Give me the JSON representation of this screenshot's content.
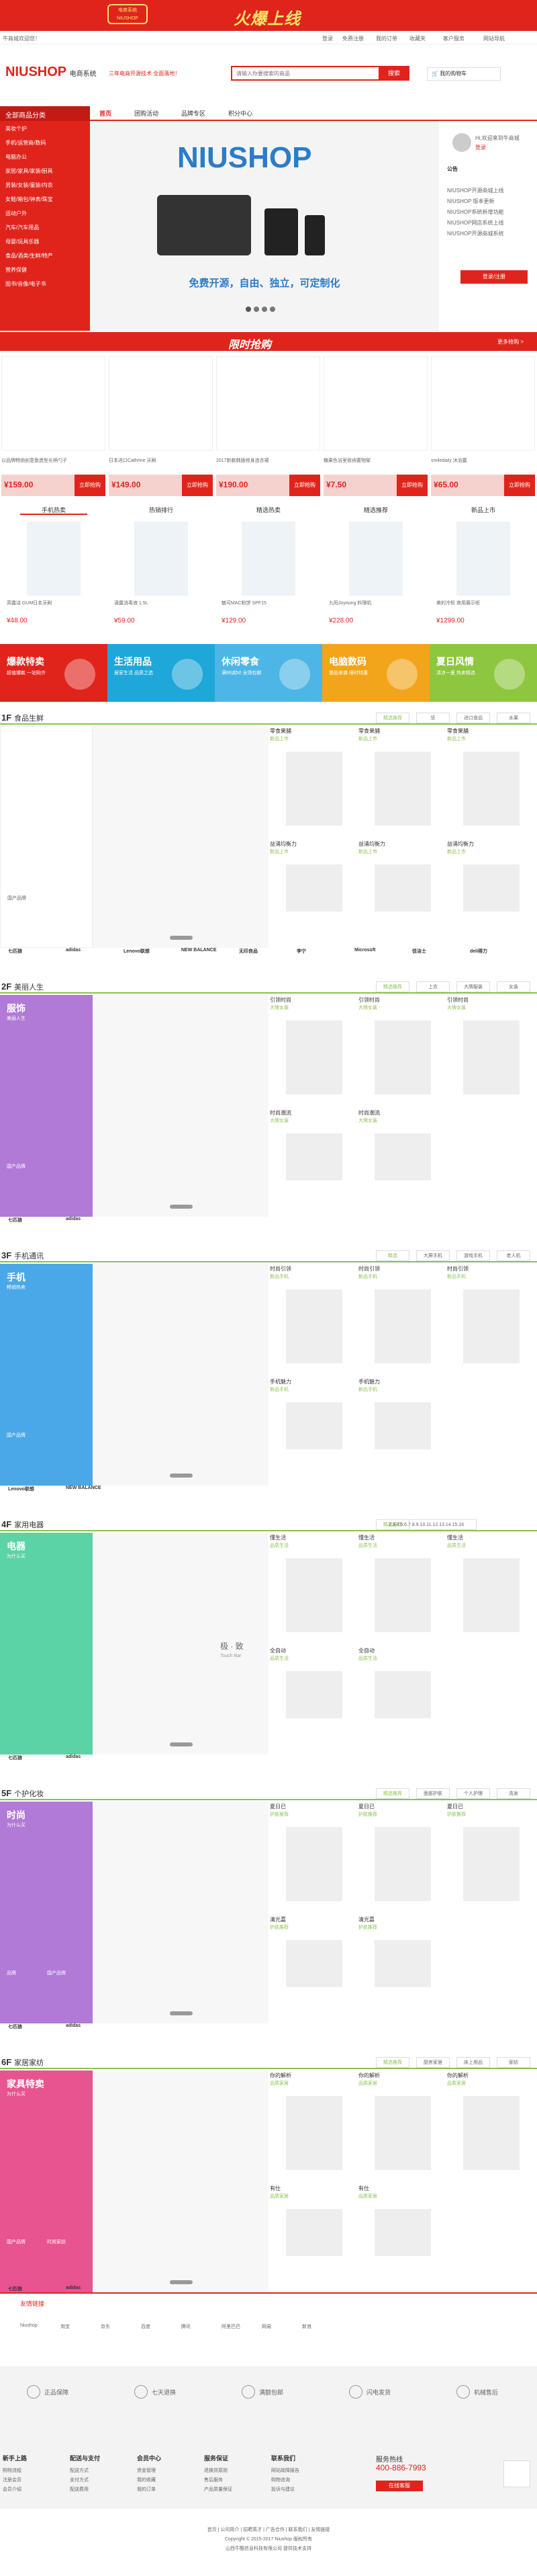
{
  "banner": {
    "title": "火爆上线",
    "sub": "NIUSHOP",
    "left_badge": "电商系统"
  },
  "topbar": {
    "left": "牛商城欢迎您！",
    "links": [
      "登录",
      "免费注册",
      "我的订单",
      "收藏夹",
      "客户服务",
      "网站导航"
    ]
  },
  "logo": {
    "text": "NIUSHOP",
    "sub": "电商系统",
    "slogan": "三年电商开源技术 全面落地！"
  },
  "search": {
    "placeholder": "请输入你要搜索的商品",
    "button": "搜索"
  },
  "cart": {
    "label": "我的购物车"
  },
  "nav": {
    "items": [
      "首页",
      "团购活动",
      "品牌专区",
      "积分中心"
    ]
  },
  "category": {
    "title": "全部商品分类",
    "items": [
      "美妆个护",
      "手机/运营商/数码",
      "电脑办公",
      "家居/家具/家装/厨具",
      "男装/女装/童装/内衣",
      "女鞋/箱包/钟表/珠宝",
      "运动户外",
      "汽车/汽车用品",
      "母婴/玩具乐器",
      "食品/酒类/生鲜/特产",
      "营养保健",
      "图书/音像/电子书"
    ]
  },
  "hero": {
    "brand": "NIUSHOP",
    "slogan": "免费开源，自由、独立，可定制化"
  },
  "sidebar": {
    "welcome": "Hi,欢迎来到牛商城",
    "login": "登录",
    "register": "注册",
    "news_title": "公告",
    "news": [
      "NIUSHOP开源商城上线",
      "NIUSHOP 版本更新",
      "NIUSHOP系统新增功能",
      "NIUSHOP网店系统上线",
      "NIUSHOP开源商城系统"
    ],
    "button": "登录/注册"
  },
  "promo": {
    "title": "限时抢购",
    "more": "更多抢购 >"
  },
  "flash": [
    {
      "name": "以品牌畅销创意鱼造型长柄勺子",
      "price": "¥159.00"
    },
    {
      "name": "日本进口Cathrine 牙刷",
      "price": "¥149.00"
    },
    {
      "name": "2017新款韩版修身连衣裙",
      "price": "¥190.00"
    },
    {
      "name": "糖果色浴室收纳置物架",
      "price": "¥7.50"
    },
    {
      "name": "smiledaily 沐浴露",
      "price": "¥65.00"
    }
  ],
  "buy_label": "立即抢购",
  "hot_tabs": [
    "手机热卖",
    "热销排行",
    "精选热卖",
    "精选推荐",
    "新品上市"
  ],
  "hot_items": [
    {
      "name": "高露洁 GUM日本牙刷",
      "price": "¥48.00"
    },
    {
      "name": "滴露消毒液 1.5L",
      "price": "¥59.00"
    },
    {
      "name": "魅可MAC粉饼 SPF15",
      "price": "¥129.00"
    },
    {
      "name": "九阳Joyoung 料理机",
      "price": "¥228.00"
    },
    {
      "name": "美的冷柜 商用展示柜",
      "price": "¥1299.00"
    }
  ],
  "banners": [
    {
      "title": "爆款特卖",
      "sub": "超值爆款 一站购齐"
    },
    {
      "title": "生活用品",
      "sub": "居家生活 品质之选"
    },
    {
      "title": "休闲零食",
      "sub": "满99减50 全场包邮"
    },
    {
      "title": "电脑数码",
      "sub": "爆品来袭 限时特惠"
    },
    {
      "title": "夏日风情",
      "sub": "清凉一夏 热卖精选"
    }
  ],
  "floors": [
    {
      "no": "1F",
      "name": "食品生鲜",
      "tabs": [
        "精选推荐",
        "坚",
        "进口食品",
        "水果"
      ],
      "items": [
        "零食果脯",
        "零食果脯",
        "零食果脯",
        "益涌均衡力",
        "益涌均衡力",
        "益涌均衡力"
      ],
      "sub": "新品上市",
      "links": [
        "国产品牌"
      ]
    },
    {
      "no": "2F",
      "name": "美丽人生",
      "tabs": [
        "精选推荐",
        "上衣",
        "大牌服装",
        "女装"
      ],
      "items": [
        "引领时尚",
        "引领时尚",
        "引领时尚",
        "时尚潮流",
        "时尚潮流"
      ],
      "sub": "大牌女装",
      "links": [
        "国产品牌"
      ],
      "left": {
        "title": "服饰",
        "sub": "美丽人生"
      }
    },
    {
      "no": "3F",
      "name": "手机通讯",
      "tabs": [
        "精选",
        "大屏手机",
        "游戏手机",
        "老人机"
      ],
      "items": [
        "时尚引领",
        "时尚引领",
        "时尚引领",
        "手机魅力",
        "手机魅力"
      ],
      "sub": "新品手机",
      "left": {
        "title": "手机",
        "sub": "畅销热卖"
      },
      "links": [
        "国产品牌"
      ]
    },
    {
      "no": "4F",
      "name": "家用电器",
      "tabs": [
        "精选推荐",
        "2.3.4.5.6.7.8.9.10.11.12.13.14.15.16"
      ],
      "items": [
        "懂生活",
        "懂生活",
        "懂生活",
        "全自动",
        "全自动"
      ],
      "sub": "品质生活",
      "left": {
        "title": "电器",
        "sub": "为什么买"
      },
      "center": {
        "title": "极 · 致",
        "sub": "Touch Bar"
      }
    },
    {
      "no": "5F",
      "name": "个护化妆",
      "tabs": [
        "精选推荐",
        "面部护肤",
        "个人护理",
        "洗发"
      ],
      "items": [
        "夏日已",
        "夏日已",
        "夏日已",
        "清光嘉",
        "清光嘉"
      ],
      "sub": "护肤推荐",
      "left": {
        "title": "时尚",
        "sub": "为什么买"
      },
      "links": [
        "品牌",
        "国产品牌"
      ]
    },
    {
      "no": "6F",
      "name": "家居家纺",
      "tabs": [
        "精选推荐",
        "厨房家居",
        "床上用品",
        "家纺"
      ],
      "items": [
        "你的解析",
        "你的解析",
        "你的解析",
        "有仕",
        "有仕"
      ],
      "sub": "品质家居",
      "left": {
        "title": "家具特卖",
        "sub": "为什么买"
      },
      "links": [
        "国产品牌",
        "时尚家纺"
      ]
    }
  ],
  "brands": [
    "七匹狼",
    "adidas",
    "Lenovo联想",
    "NEW BALANCE",
    "无印良品",
    "李宁",
    "Microsoft",
    "佳洁士",
    "deli得力"
  ],
  "friend": {
    "title": "友情链接",
    "links": [
      "Niushop",
      "淘宝",
      "京东",
      "百度",
      "腾讯",
      "阿里巴巴",
      "网易",
      "新浪"
    ]
  },
  "services": [
    "正品保障",
    "七天退换",
    "满额包邮",
    "闪电发货",
    "机械售后"
  ],
  "footer_cols": [
    {
      "title": "新手上路",
      "links": [
        "购物流程",
        "注册会员",
        "会员介绍"
      ]
    },
    {
      "title": "配送与支付",
      "links": [
        "配送方式",
        "支付方式",
        "配送费用"
      ]
    },
    {
      "title": "会员中心",
      "links": [
        "资金管理",
        "我的收藏",
        "我的订单"
      ]
    },
    {
      "title": "服务保证",
      "links": [
        "退换货原则",
        "售后服务",
        "产品质量保证"
      ]
    },
    {
      "title": "联系我们",
      "links": [
        "网站故障报告",
        "购物咨询",
        "投诉与建议"
      ]
    }
  ],
  "hotline": {
    "title": "服务热线",
    "number": "400-886-7993",
    "button": "在线客服"
  },
  "copyright": [
    "首页 | 公司简介 | 招聘英才 | 广告合作 | 联系我们 | 友情链接",
    "Copyright © 2015-2017 Niushop 版权所有",
    "山西牛酷信息科技有限公司 提供技术支持"
  ],
  "colors": {
    "brand": "#e0241c",
    "floor_line": "#8cc152"
  }
}
